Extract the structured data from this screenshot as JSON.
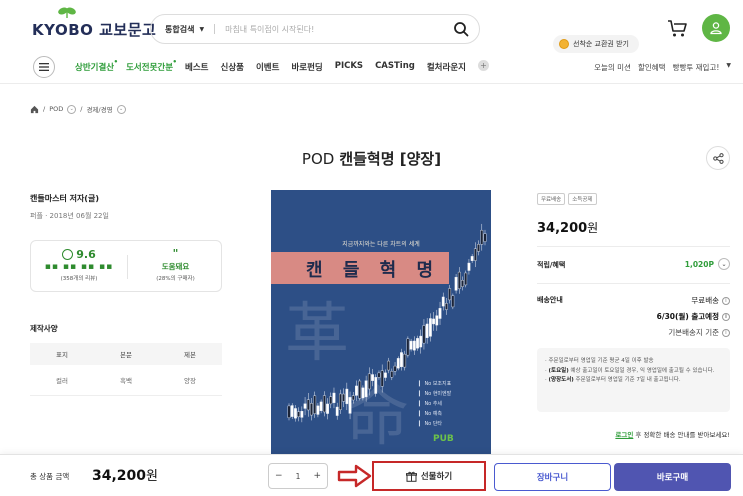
{
  "header": {
    "logo_text": "KYOBO 교보문고",
    "search": {
      "scope": "통합검색",
      "placeholder": "마침내 특이점이 시작된다!"
    },
    "promo_chip": "선착순 교환권 받기"
  },
  "nav": {
    "items": [
      {
        "label": "상반기결산",
        "highlight": true,
        "dot": true
      },
      {
        "label": "도서전못간분",
        "highlight": true,
        "dot": true
      },
      {
        "label": "베스트",
        "highlight": false
      },
      {
        "label": "신상품",
        "highlight": false
      },
      {
        "label": "이벤트",
        "highlight": false
      },
      {
        "label": "바로펀딩",
        "highlight": false
      },
      {
        "label": "PICKS",
        "highlight": false
      },
      {
        "label": "CASTing",
        "highlight": false
      },
      {
        "label": "컬처라운지",
        "highlight": false
      }
    ],
    "plus": "+",
    "right": [
      "오늘의 미션",
      "할인혜택",
      "빵빵투 재입고!"
    ]
  },
  "breadcrumb": {
    "level1": "POD",
    "level2": "경제/경영"
  },
  "product": {
    "title_prefix": "POD",
    "title": "캔들혁명 [양장]",
    "author": "캔들마스터 저자(글)",
    "pubdate": "퍼플 · 2018년 06월 22일",
    "rating": {
      "score": "9.6",
      "review_icons": "▪▪ ▪▪ ▪▪ ▪▪",
      "review_count": "(358개의 리뷰)",
      "quote": "\"",
      "helpful": "도움돼요",
      "helpful_pct": "(28%의 구매자)"
    },
    "spec": {
      "title": "제작사양",
      "headers": [
        "표지",
        "본문",
        "제본"
      ],
      "values": [
        "컬러",
        "흑백",
        "양장"
      ]
    },
    "cover": {
      "subtitle": "지금까지와는 다른 차트의 세계",
      "title": "캔 들 혁 명",
      "big_char_1": "革",
      "big_char_2": "命",
      "list": [
        "No 보조지표",
        "No 현미엔발",
        "No 추세",
        "No 예측",
        "No 단타"
      ],
      "publisher": "PUB"
    },
    "tags": [
      "무료배송",
      "소득공제"
    ],
    "price": "34,200",
    "price_unit": "원",
    "points_label": "적립/혜택",
    "points_value": "1,020P",
    "shipping_label": "배송안내",
    "shipping_free": "무료배송",
    "shipping_due": "6/30(월) 출고예정",
    "shipping_std": "기본배송지 기준",
    "notice": {
      "line1": "주문일로부터 영업일 기준 평균 4일 이후 발송",
      "line2_b": "(토요일)",
      "line2": " 예상 출고일이 토요일일 경우, 익 영업일에 출고될 수 있습니다.",
      "line3_b": "(양장도서)",
      "line3": " 주문일로부터 영업일 기준 7일 내 출고됩니다."
    },
    "login_link": "로그인",
    "login_text": "후 정확한 배송 안내를 받아보세요!"
  },
  "bottom": {
    "total_label": "총 상품 금액",
    "total_value": "34,200",
    "total_unit": "원",
    "qty_minus": "−",
    "qty": "1",
    "qty_plus": "+",
    "gift_label": "선물하기",
    "cart_label": "장바구니",
    "buy_label": "바로구매"
  },
  "colors": {
    "brand_green": "#5fb645",
    "accent_green": "#2f9d3a",
    "buy_purple": "#5055b1",
    "cart_blue": "#4a5ad0",
    "highlight_red": "#c62828"
  }
}
